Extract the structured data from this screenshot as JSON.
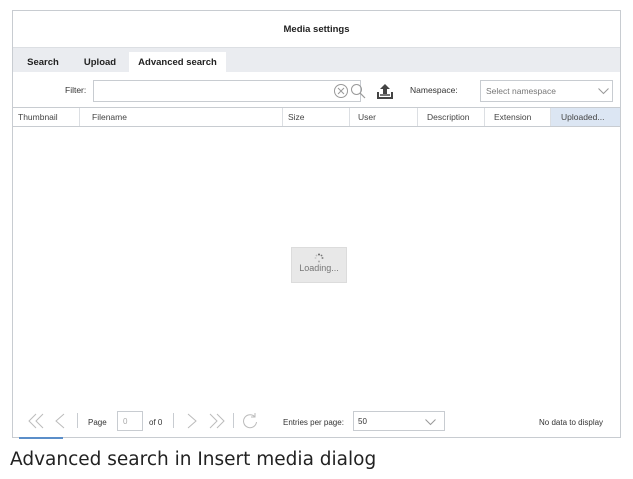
{
  "dialog": {
    "title": "Media settings"
  },
  "tabs": [
    {
      "label": "Search"
    },
    {
      "label": "Upload"
    },
    {
      "label": "Advanced search",
      "active": true
    }
  ],
  "filter": {
    "label": "Filter:",
    "value": "",
    "icons": [
      "clear-icon",
      "search-icon",
      "upload-icon"
    ]
  },
  "namespace": {
    "label": "Namespace:",
    "placeholder": "Select namespace"
  },
  "columns": [
    {
      "label": "Thumbnail"
    },
    {
      "label": "Filename"
    },
    {
      "label": "Size"
    },
    {
      "label": "User"
    },
    {
      "label": "Description"
    },
    {
      "label": "Extension"
    },
    {
      "label": "Uploaded...",
      "sorted": true
    }
  ],
  "grid": {
    "loading_text": "Loading..."
  },
  "pager": {
    "page_label": "Page",
    "page_value": "0",
    "of_label": "of 0",
    "entries_label": "Entries per page:",
    "entries_value": "50",
    "status": "No data to display"
  },
  "caption": "Advanced search in Insert media dialog",
  "colors": {
    "sorted_header": "#dce6f3",
    "tab_bar": "#eaecf0",
    "border": "#c8ccd1"
  }
}
